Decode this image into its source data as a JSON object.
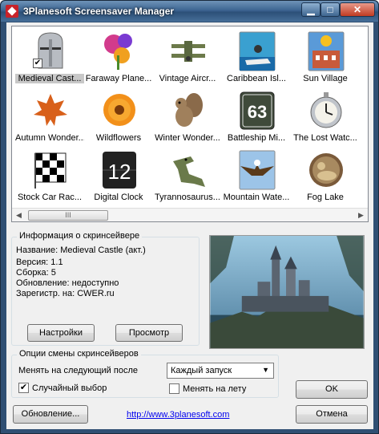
{
  "window": {
    "title": "3Planesoft Screensaver Manager",
    "minimize": "▁",
    "maximize": "□",
    "close": "✕"
  },
  "gallery": {
    "items": [
      {
        "label": "Medieval Cast...",
        "icon": "knight-helmet-icon",
        "selected": true,
        "checked": true
      },
      {
        "label": "Faraway Plane...",
        "icon": "alien-flower-icon"
      },
      {
        "label": "Vintage Aircr...",
        "icon": "biplane-icon"
      },
      {
        "label": "Caribbean Isl...",
        "icon": "jetski-icon"
      },
      {
        "label": "Sun Village",
        "icon": "village-icon"
      },
      {
        "label": "Autumn Wonder...",
        "icon": "maple-leaf-icon"
      },
      {
        "label": "Wildflowers",
        "icon": "flower-icon"
      },
      {
        "label": "Winter Wonder...",
        "icon": "squirrel-icon"
      },
      {
        "label": "Battleship Mi...",
        "icon": "number-sign-icon",
        "glyph": "63"
      },
      {
        "label": "The Lost Watc...",
        "icon": "pocket-watch-icon"
      },
      {
        "label": "Stock Car Rac...",
        "icon": "checkered-flag-icon"
      },
      {
        "label": "Digital Clock",
        "icon": "flip-clock-icon",
        "glyph": "12"
      },
      {
        "label": "Tyrannosaurus...",
        "icon": "dinosaur-icon"
      },
      {
        "label": "Mountain Wate...",
        "icon": "eagle-icon"
      },
      {
        "label": "Fog Lake",
        "icon": "duck-icon"
      }
    ],
    "scroll_thumb": "III"
  },
  "info": {
    "title": "Информация о скринсейвере",
    "name": "Название: Medieval Castle (акт.)",
    "version": "Версия: 1.1",
    "build": "Сборка: 5",
    "update": "Обновление: недоступно",
    "registered": "Зарегистр. на:  CWER.ru",
    "settings_button": "Настройки",
    "preview_button": "Просмотр"
  },
  "options": {
    "title": "Опции смены скринсейверов",
    "change_label": "Менять на следующий после",
    "change_value": "Каждый запуск",
    "random_label": "Случайный выбор",
    "random_checked": true,
    "onthefly_label": "Менять на лету",
    "onthefly_checked": false
  },
  "buttons": {
    "ok": "OK",
    "update": "Обновление...",
    "cancel": "Отмена"
  },
  "link": "http://www.3planesoft.com"
}
